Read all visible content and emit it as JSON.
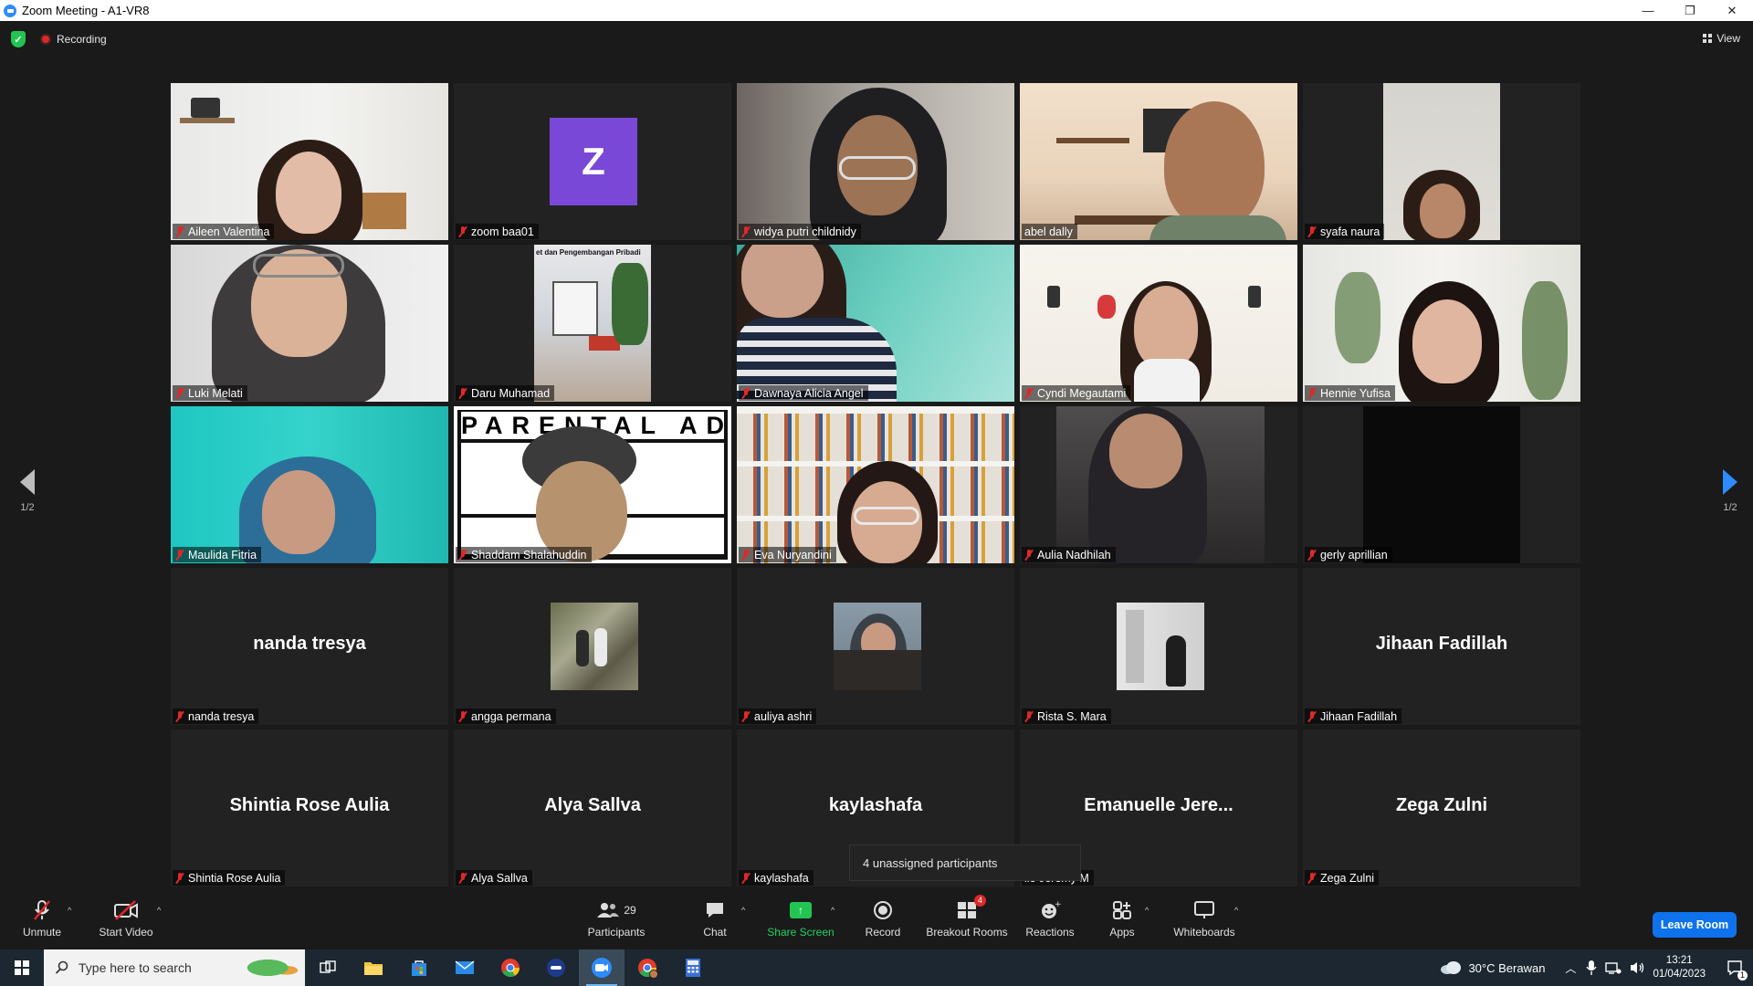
{
  "window": {
    "title": "Zoom Meeting - A1-VR8"
  },
  "meeting_top": {
    "recording_label": "Recording",
    "view_label": "View"
  },
  "pagination": {
    "left": "1/2",
    "right": "1/2"
  },
  "tiles": [
    {
      "name": "Aileen Valentina",
      "display": "video"
    },
    {
      "name": "zoom baa01",
      "display": "avatar",
      "initial": "Z"
    },
    {
      "name": "widya putri childnidy",
      "display": "video"
    },
    {
      "name": "abel dally",
      "display": "video",
      "active_speaker": true
    },
    {
      "name": "syafa naura",
      "display": "video"
    },
    {
      "name": "Luki Melati",
      "display": "video"
    },
    {
      "name": "Daru Muhamad",
      "display": "video",
      "overlay_text": "et dan Pengembangan Pribadi"
    },
    {
      "name": "Dawnaya Alicia Angel",
      "display": "video"
    },
    {
      "name": "Cyndi Megautami",
      "display": "video"
    },
    {
      "name": "Hennie Yufisa",
      "display": "video"
    },
    {
      "name": "Maulida Fitria",
      "display": "video"
    },
    {
      "name": "Shaddam Shalahuddin",
      "display": "video",
      "overlay_text": "PARENTAL ADVISORY"
    },
    {
      "name": "Eva Nuryandini",
      "display": "video"
    },
    {
      "name": "Aulia Nadhilah",
      "display": "video"
    },
    {
      "name": "gerly aprillian",
      "display": "video"
    },
    {
      "name": "nanda tresya",
      "display": "name",
      "big_name": "nanda tresya"
    },
    {
      "name": "angga permana",
      "display": "picture"
    },
    {
      "name": "auliya ashri",
      "display": "picture"
    },
    {
      "name": "Rista S. Mara",
      "display": "picture"
    },
    {
      "name": "Jihaan Fadillah",
      "display": "name",
      "big_name": "Jihaan Fadillah"
    },
    {
      "name": "Shintia Rose Aulia",
      "display": "name",
      "big_name": "Shintia Rose Aulia"
    },
    {
      "name": "Alya Sallva",
      "display": "name",
      "big_name": "Alya Sallva"
    },
    {
      "name": "kaylashafa",
      "display": "name",
      "big_name": "kaylashafa"
    },
    {
      "name": "lle Jeremy M",
      "display": "name",
      "big_name": "Emanuelle Jere..."
    },
    {
      "name": "Zega Zulni",
      "display": "name",
      "big_name": "Zega Zulni"
    }
  ],
  "tooltip": {
    "text": "4 unassigned participants"
  },
  "toolbar": {
    "unmute": "Unmute",
    "start_video": "Start Video",
    "participants": "Participants",
    "participants_count": "29",
    "chat": "Chat",
    "share_screen": "Share Screen",
    "record": "Record",
    "breakout_rooms": "Breakout Rooms",
    "breakout_badge": "4",
    "reactions": "Reactions",
    "apps": "Apps",
    "whiteboards": "Whiteboards",
    "leave": "Leave Room"
  },
  "taskbar": {
    "search_placeholder": "Type here to search",
    "weather": "30°C  Berawan",
    "time": "13:21",
    "date": "01/04/2023",
    "notification_count": "1"
  },
  "colors": {
    "accent": "#2d8cff",
    "leave": "#0e72ed",
    "active_speaker": "#ffee58",
    "share": "#23c552",
    "muted": "#e02828"
  }
}
